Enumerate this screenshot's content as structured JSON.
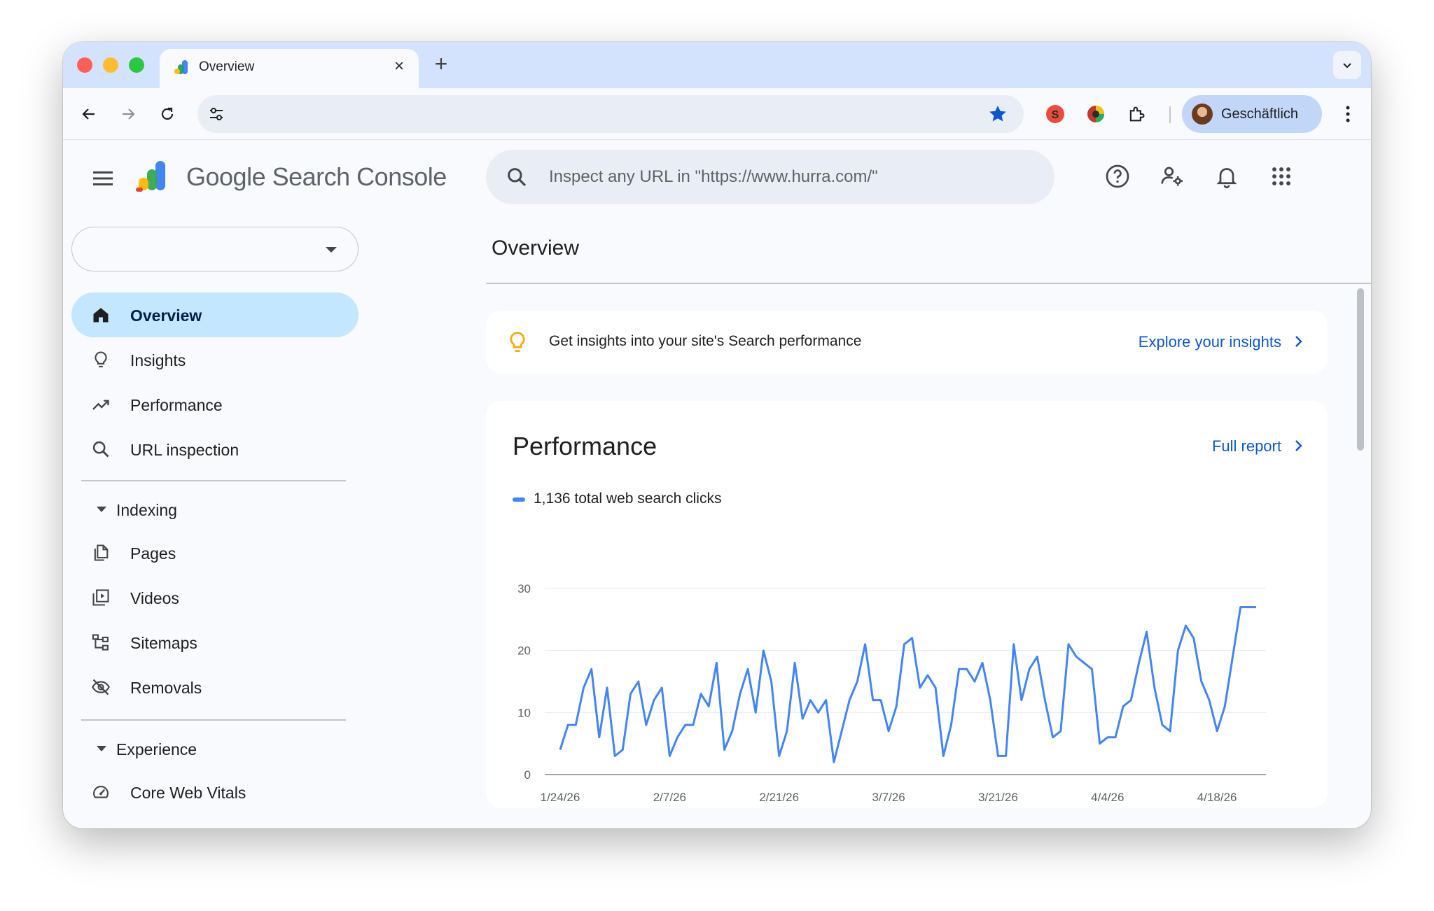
{
  "browser": {
    "tab_title": "Overview",
    "new_tab_icon": "plus-icon",
    "profile_name": "Geschäftlich",
    "extensions": [
      "seo-extension-icon",
      "color-extension-icon",
      "puzzle-extension-icon"
    ],
    "omnibox_value": ""
  },
  "app": {
    "brand_google": "Google",
    "brand_product": "Search Console",
    "search_placeholder": "Inspect any URL in \"https://www.hurra.com/\"",
    "header_icons": [
      "help-icon",
      "manage-users-icon",
      "notifications-icon",
      "apps-grid-icon"
    ]
  },
  "sidebar": {
    "property_value": "",
    "items": [
      {
        "label": "Overview",
        "icon": "home-icon",
        "active": true
      },
      {
        "label": "Insights",
        "icon": "lightbulb-icon",
        "active": false
      },
      {
        "label": "Performance",
        "icon": "trending-up-icon",
        "active": false
      },
      {
        "label": "URL inspection",
        "icon": "search-icon",
        "active": false
      }
    ],
    "indexing": {
      "label": "Indexing",
      "items": [
        {
          "label": "Pages",
          "icon": "pages-icon"
        },
        {
          "label": "Videos",
          "icon": "videos-icon"
        },
        {
          "label": "Sitemaps",
          "icon": "sitemaps-icon"
        },
        {
          "label": "Removals",
          "icon": "removals-icon"
        }
      ]
    },
    "experience": {
      "label": "Experience",
      "items": [
        {
          "label": "Core Web Vitals",
          "icon": "speed-gauge-icon"
        }
      ]
    }
  },
  "main": {
    "page_title": "Overview",
    "insight_banner": {
      "text": "Get insights into your site's Search performance",
      "link": "Explore your insights"
    },
    "performance": {
      "title": "Performance",
      "link": "Full report",
      "legend": "1,136 total web search clicks"
    }
  },
  "colors": {
    "accent_blue": "#0b57d0",
    "active_nav": "#c2e7ff",
    "series_line": "#4285f4",
    "tabstrip": "#d3e3fd"
  },
  "chart_data": {
    "type": "line",
    "series": [
      {
        "name": "1,136 total web search clicks",
        "values": [
          4,
          8,
          8,
          14,
          17,
          6,
          14,
          3,
          4,
          13,
          15,
          8,
          12,
          14,
          3,
          6,
          8,
          8,
          13,
          11,
          18,
          4,
          7,
          13,
          17,
          10,
          20,
          15,
          3,
          7,
          18,
          9,
          12,
          10,
          12,
          2,
          7,
          12,
          15,
          21,
          12,
          12,
          7,
          11,
          21,
          22,
          14,
          16,
          14,
          3,
          8,
          17,
          17,
          15,
          18,
          12,
          3,
          3,
          21,
          12,
          17,
          19,
          12,
          6,
          7,
          21,
          19,
          18,
          17,
          5,
          6,
          6,
          11,
          12,
          18,
          23,
          14,
          8,
          7,
          20,
          24,
          22,
          15,
          12,
          7,
          11,
          19,
          27,
          27,
          27
        ]
      }
    ],
    "x_start": "1/24/26",
    "x_end": "4/23/26",
    "x_ticks": [
      "1/24/26",
      "2/7/26",
      "2/21/26",
      "3/7/26",
      "3/21/26",
      "4/4/26",
      "4/18/26"
    ],
    "y_ticks": [
      0,
      10,
      20,
      30
    ],
    "ylim": [
      0,
      30
    ],
    "grid": true,
    "xlabel": "",
    "ylabel": ""
  }
}
